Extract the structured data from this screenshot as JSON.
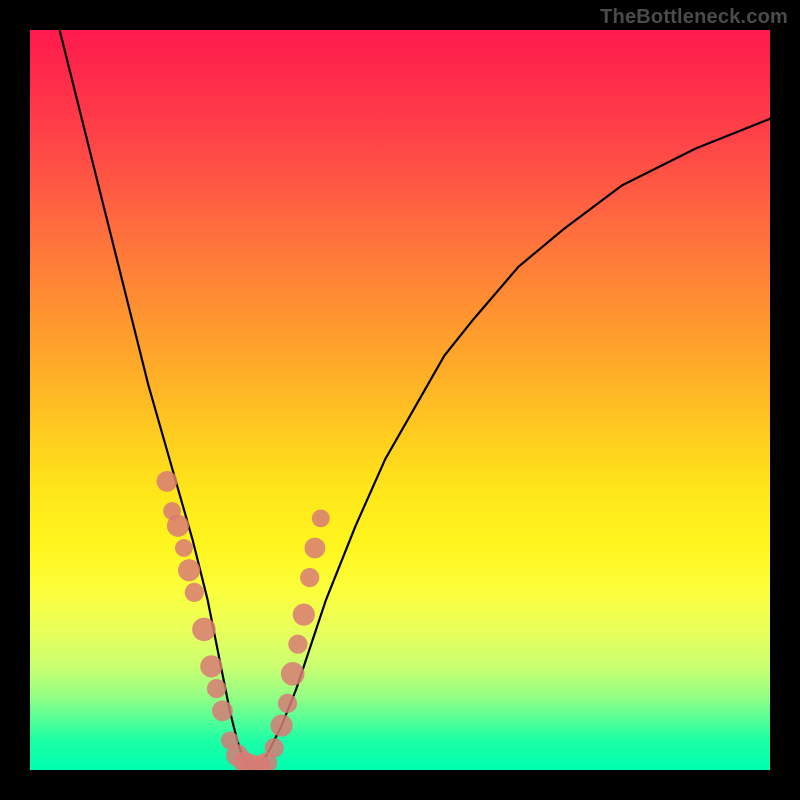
{
  "watermark": {
    "text": "TheBottleneck.com"
  },
  "chart_data": {
    "type": "line",
    "title": "",
    "xlabel": "",
    "ylabel": "",
    "xlim": [
      0,
      100
    ],
    "ylim": [
      0,
      100
    ],
    "grid": false,
    "legend": false,
    "series": [
      {
        "name": "bottleneck-curve",
        "x": [
          4,
          6,
          8,
          10,
          12,
          14,
          16,
          18,
          20,
          22,
          24,
          25,
          26,
          27,
          28,
          29,
          30,
          32,
          34,
          36,
          38,
          40,
          44,
          48,
          52,
          56,
          60,
          66,
          72,
          80,
          90,
          100
        ],
        "y": [
          100,
          92,
          84,
          76,
          68,
          60,
          52,
          45,
          38,
          31,
          23,
          18,
          13,
          8,
          4,
          1,
          0,
          2,
          6,
          11,
          17,
          23,
          33,
          42,
          49,
          56,
          61,
          68,
          73,
          79,
          84,
          88
        ]
      }
    ],
    "markers": [
      {
        "x": 18.5,
        "y": 39,
        "r": 1.4
      },
      {
        "x": 19.2,
        "y": 35,
        "r": 1.2
      },
      {
        "x": 20.0,
        "y": 33,
        "r": 1.5
      },
      {
        "x": 20.8,
        "y": 30,
        "r": 1.2
      },
      {
        "x": 21.5,
        "y": 27,
        "r": 1.5
      },
      {
        "x": 22.2,
        "y": 24,
        "r": 1.3
      },
      {
        "x": 23.5,
        "y": 19,
        "r": 1.6
      },
      {
        "x": 24.5,
        "y": 14,
        "r": 1.5
      },
      {
        "x": 25.2,
        "y": 11,
        "r": 1.3
      },
      {
        "x": 26.0,
        "y": 8,
        "r": 1.4
      },
      {
        "x": 27.0,
        "y": 4,
        "r": 1.2
      },
      {
        "x": 28.0,
        "y": 2,
        "r": 1.5
      },
      {
        "x": 29.0,
        "y": 1,
        "r": 1.5
      },
      {
        "x": 30.0,
        "y": 0.5,
        "r": 1.6
      },
      {
        "x": 31.0,
        "y": 0.5,
        "r": 1.5
      },
      {
        "x": 32.0,
        "y": 1,
        "r": 1.4
      },
      {
        "x": 33.0,
        "y": 3,
        "r": 1.3
      },
      {
        "x": 34.0,
        "y": 6,
        "r": 1.5
      },
      {
        "x": 34.8,
        "y": 9,
        "r": 1.3
      },
      {
        "x": 35.5,
        "y": 13,
        "r": 1.6
      },
      {
        "x": 36.2,
        "y": 17,
        "r": 1.3
      },
      {
        "x": 37.0,
        "y": 21,
        "r": 1.5
      },
      {
        "x": 37.8,
        "y": 26,
        "r": 1.3
      },
      {
        "x": 38.5,
        "y": 30,
        "r": 1.4
      },
      {
        "x": 39.3,
        "y": 34,
        "r": 1.2
      }
    ]
  }
}
